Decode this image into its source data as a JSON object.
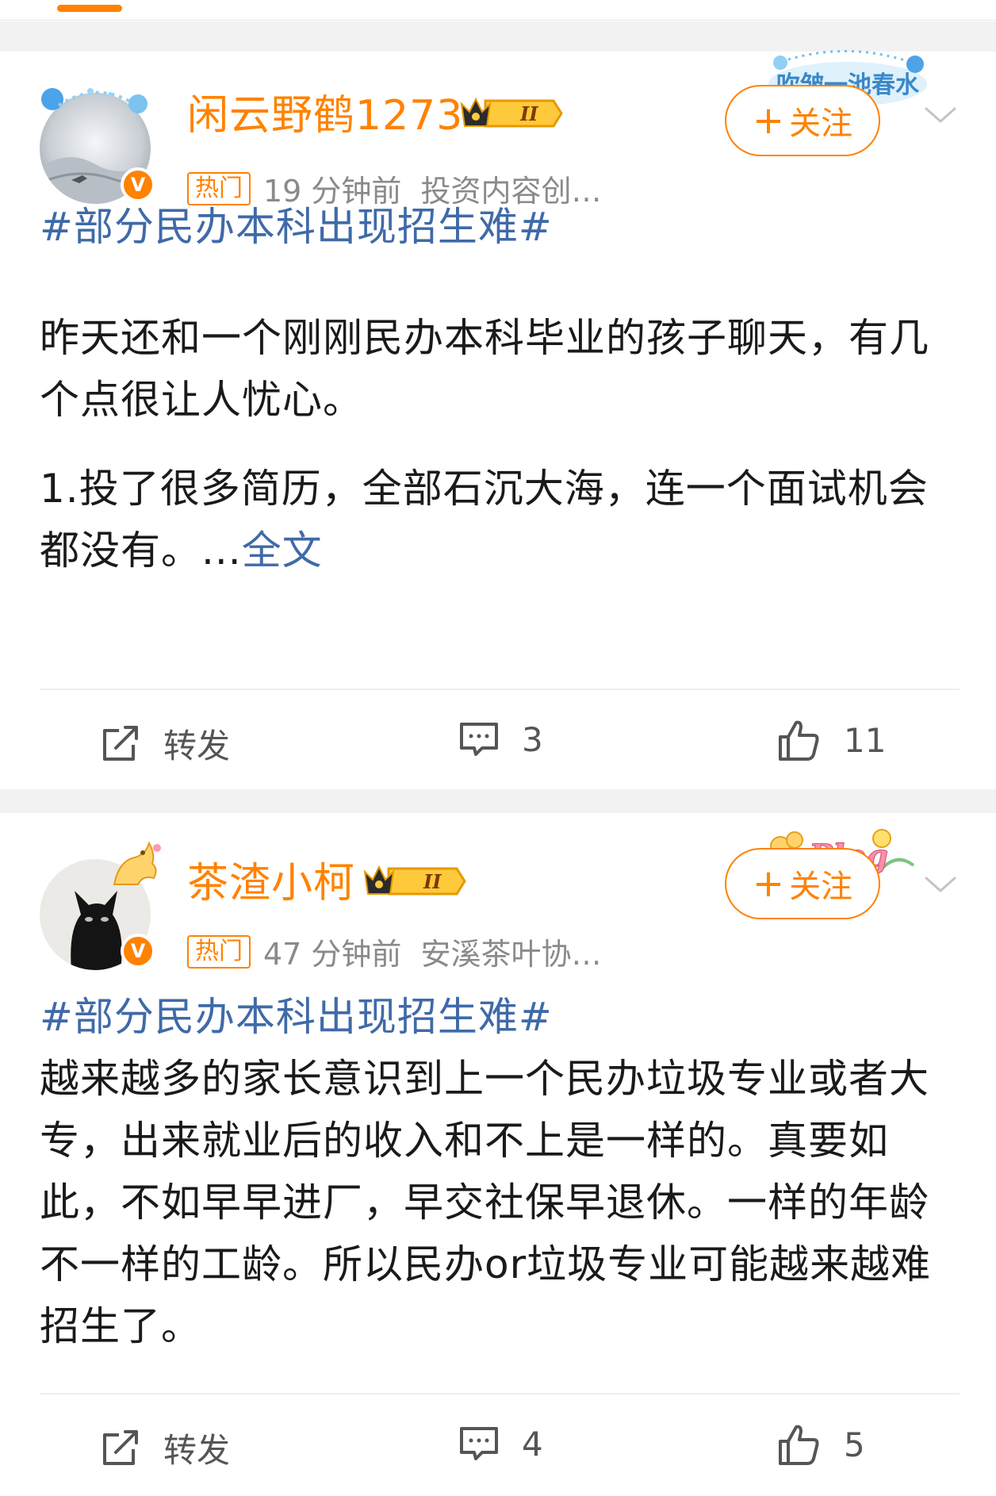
{
  "posts": [
    {
      "username": "闲云野鹤1273",
      "level": "II",
      "hot_tag": "热门",
      "time": "19 分钟前",
      "source": "投资内容创…",
      "follow_label": "关注",
      "deco_text": "吹皱一池春水",
      "topic": "#部分民办本科出现招生难#",
      "paragraphs": [
        "昨天还和一个刚刚民办本科毕业的孩子聊天，有几个点很让人忧心。",
        "1.投了很多简历，全部石沉大海，连一个面试机会都没有。..."
      ],
      "full_text_link": "全文",
      "repost_label": "转发",
      "comment_count": "3",
      "like_count": "11"
    },
    {
      "username": "茶渣小柯",
      "level": "II",
      "hot_tag": "热门",
      "time": "47 分钟前",
      "source": "安溪茶叶协…",
      "follow_label": "关注",
      "deco_text": "Plog",
      "topic": "#部分民办本科出现招生难#",
      "paragraphs": [
        "越来越多的家长意识到上一个民办垃圾专业或者大专，出来就业后的收入和不上是一样的。真要如此，不如早早进厂，早交社保早退休。一样的年龄不一样的工龄。所以民办or垃圾专业可能越来越难招生了。"
      ],
      "repost_label": "转发",
      "comment_count": "4",
      "like_count": "5"
    }
  ],
  "colors": {
    "accent": "#ff8200",
    "link": "#3f6aa8",
    "meta": "#8a8a8a",
    "background_gap": "#f2f2f2"
  },
  "icons": [
    "repost-icon",
    "comment-icon",
    "like-icon",
    "chevron-down-icon",
    "verified-icon",
    "crown-icon",
    "plus-icon"
  ]
}
